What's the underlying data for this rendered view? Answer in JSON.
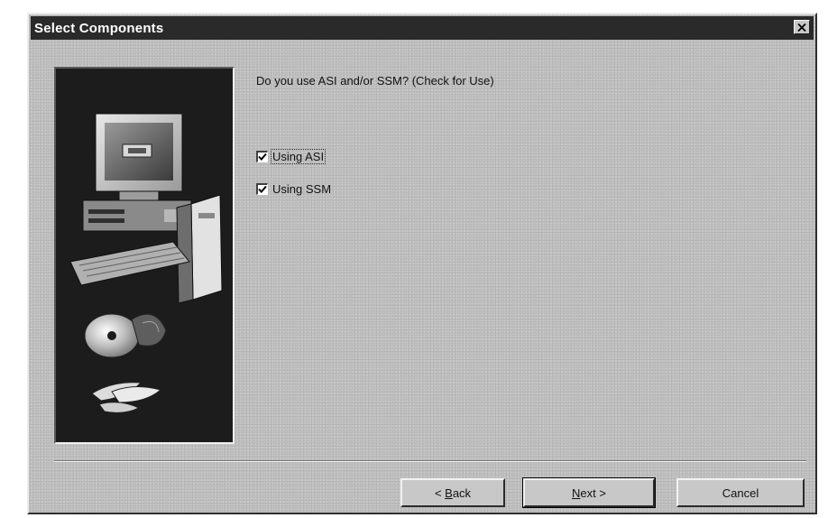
{
  "window": {
    "title": "Select Components"
  },
  "main": {
    "question": "Do you use ASI and/or SSM? (Check for Use)",
    "options": [
      {
        "label": "Using ASI",
        "checked": true
      },
      {
        "label": "Using SSM",
        "checked": true
      }
    ]
  },
  "buttons": {
    "back_prefix": "< ",
    "back_accel": "B",
    "back_rest": "ack",
    "next_prefix": "",
    "next_accel": "N",
    "next_rest": "ext >",
    "cancel_label": "Cancel"
  },
  "icons": {
    "close": "close-icon",
    "illustration": "computer-with-cds-illustration",
    "checkmark": "checkmark-icon"
  }
}
